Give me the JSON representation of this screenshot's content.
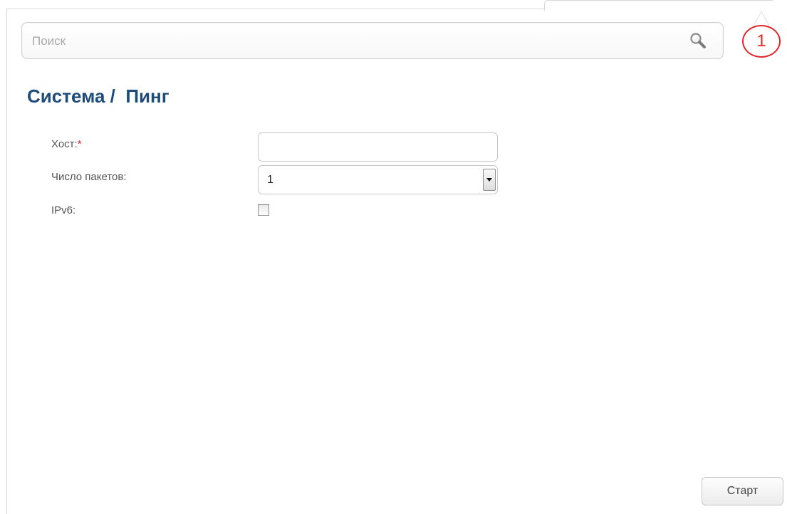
{
  "search": {
    "placeholder": "Поиск",
    "icon": "search-icon"
  },
  "notifications": {
    "count": "1",
    "color": "#e2262b"
  },
  "page": {
    "title": "Система /  Пинг",
    "title_color": "#1d4b7a"
  },
  "form": {
    "host": {
      "label": "Хост:",
      "required_mark": "*",
      "value": ""
    },
    "packet_count": {
      "label": "Число пакетов:",
      "selected": "1"
    },
    "ipv6": {
      "label": "IPv6:",
      "checked": false
    }
  },
  "actions": {
    "start_label": "Старт"
  }
}
